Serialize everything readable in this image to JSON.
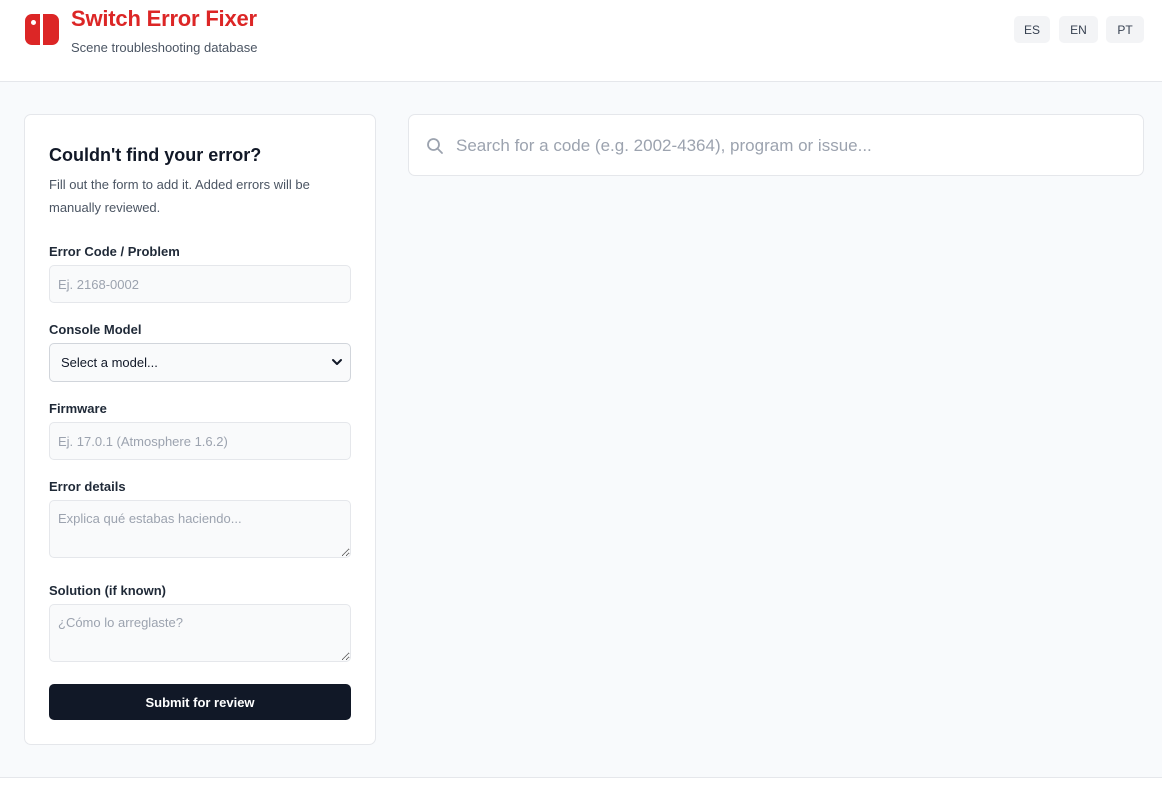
{
  "header": {
    "title": "Switch Error Fixer",
    "subtitle": "Scene troubleshooting database",
    "logo_icon": "switch-console-icon",
    "languages": [
      "ES",
      "EN",
      "PT"
    ]
  },
  "colors": {
    "brand": "#dc2626",
    "button_dark": "#111827",
    "background": "#f8fafc"
  },
  "form": {
    "title": "Couldn't find your error?",
    "description": "Fill out the form to add it. Added errors will be manually reviewed.",
    "error_code_label": "Error Code / Problem",
    "error_code_placeholder": "Ej. 2168-0002",
    "model_label": "Console Model",
    "model_selected": "Select a model...",
    "firmware_label": "Firmware",
    "firmware_placeholder": "Ej. 17.0.1 (Atmosphere 1.6.2)",
    "details_label": "Error details",
    "details_placeholder": "Explica qué estabas haciendo...",
    "solution_label": "Solution (if known)",
    "solution_placeholder": "¿Cómo lo arreglaste?",
    "submit_label": "Submit for review"
  },
  "search": {
    "icon": "search-icon",
    "placeholder": "Search for a code (e.g. 2002-4364), program or issue..."
  }
}
